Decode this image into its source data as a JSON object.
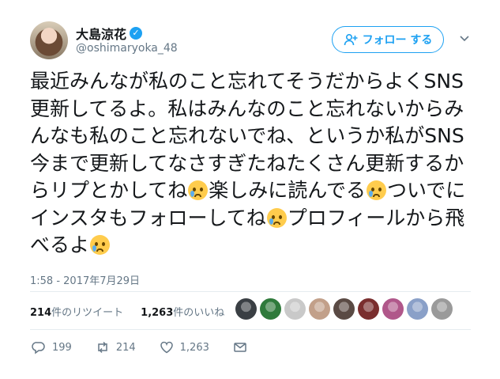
{
  "user": {
    "name": "大島涼花",
    "handle": "@oshimaryoka_48",
    "verified": true
  },
  "follow_button": {
    "label": "フォロー する",
    "icon": "add-user-icon"
  },
  "tweet": {
    "segments": [
      {
        "text": "最近みんなが私のこと忘れてそうだからよくSNS更新してるよ。私はみんなのこと忘れないからみんなも私のこと忘れないでね、というか私がSNS今まで更新してなさすぎたねたくさん更新するからリプとかしてね"
      },
      {
        "emoji": "crying-face"
      },
      {
        "text": "楽しみに読んでる"
      },
      {
        "emoji": "crying-face"
      },
      {
        "text": "ついでにインスタもフォローしてね"
      },
      {
        "emoji": "crying-face"
      },
      {
        "text": "プロフィールから飛べるよ"
      },
      {
        "emoji": "crying-face"
      }
    ],
    "timestamp": "1:58 - 2017年7月29日"
  },
  "stats": {
    "retweets_count": "214",
    "retweets_label": "件のリツイート",
    "likes_count": "1,263",
    "likes_label": "件のいいね"
  },
  "likers": {
    "colors": [
      "#3a3f44",
      "#2f7a3b",
      "#c9c9c9",
      "#c2a08a",
      "#5a4a44",
      "#7a2e2e",
      "#b0578a",
      "#8aa0c8",
      "#9a9a9a"
    ]
  },
  "actions": {
    "reply": "199",
    "retweet": "214",
    "like": "1,263"
  },
  "colors": {
    "accent": "#1da1f2",
    "secondary": "#657786"
  }
}
